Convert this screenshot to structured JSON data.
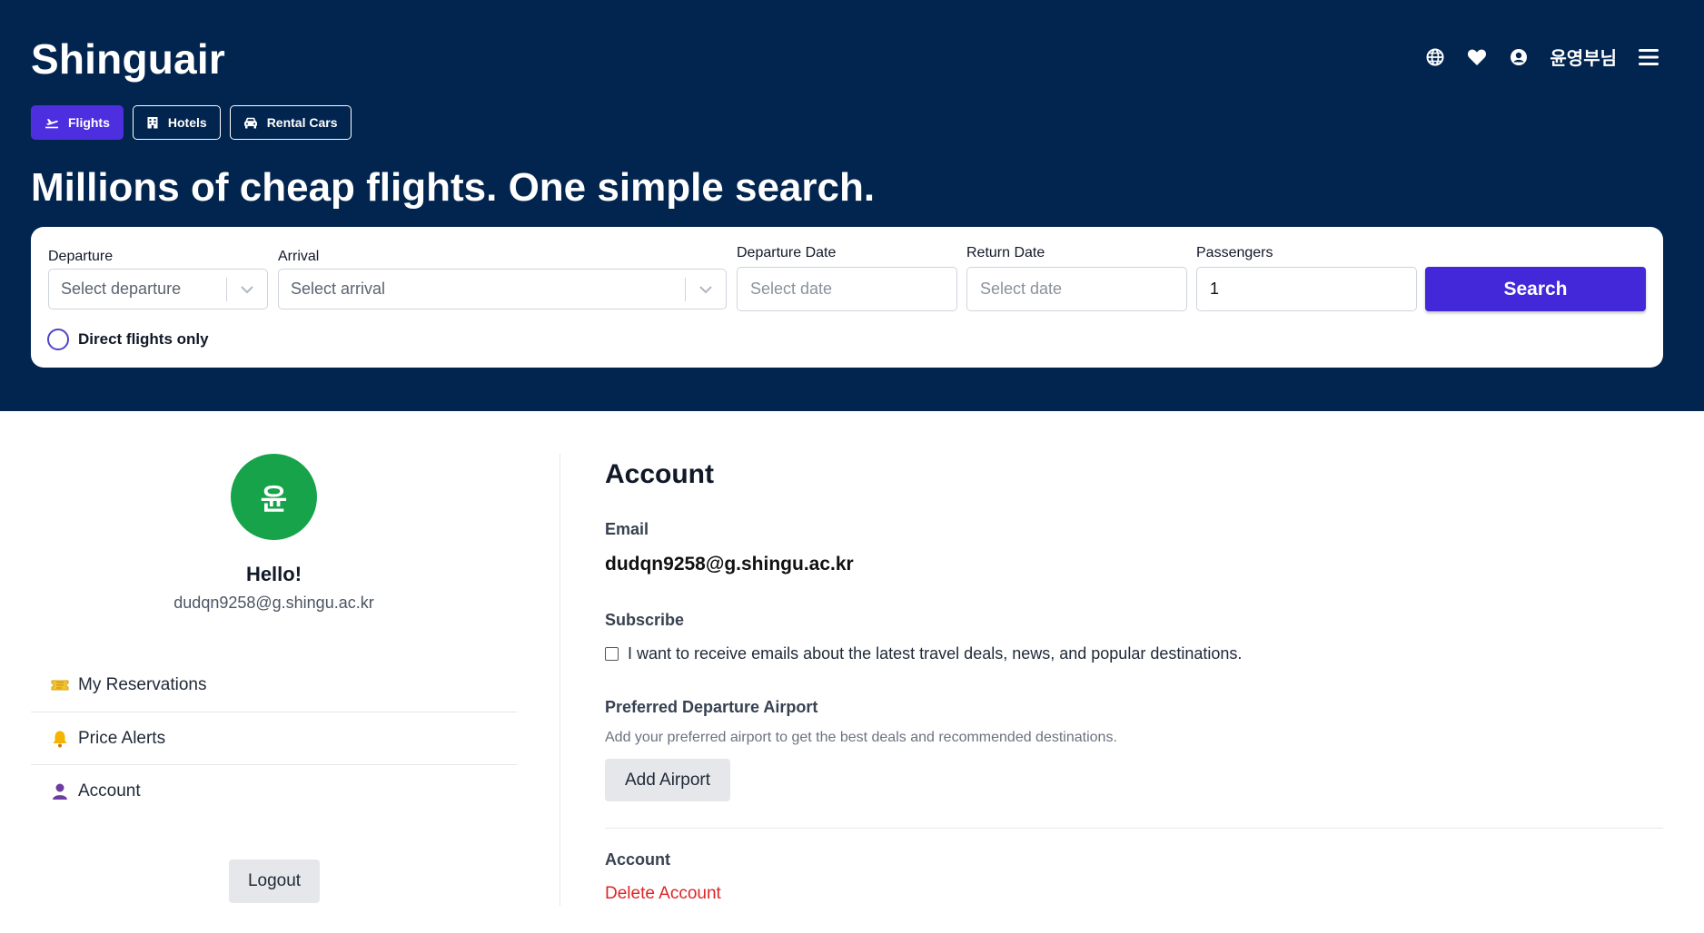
{
  "header": {
    "brand": "Shinguair",
    "user_name": "윤영부님",
    "icons": [
      "globe-icon",
      "heart-icon",
      "user-icon",
      "hamburger-menu-icon"
    ]
  },
  "categories": [
    {
      "label": "Flights",
      "icon": "plane-icon",
      "active": true
    },
    {
      "label": "Hotels",
      "icon": "hotel-icon",
      "active": false
    },
    {
      "label": "Rental Cars",
      "icon": "car-icon",
      "active": false
    }
  ],
  "hero": {
    "headline": "Millions of cheap flights. One simple search."
  },
  "search": {
    "departure_label": "Departure",
    "departure_placeholder": "Select departure",
    "arrival_label": "Arrival",
    "arrival_placeholder": "Select arrival",
    "departure_date_label": "Departure Date",
    "departure_date_placeholder": "Select date",
    "return_date_label": "Return Date",
    "return_date_placeholder": "Select date",
    "passengers_label": "Passengers",
    "passengers_value": "1",
    "search_button": "Search",
    "direct_only_label": "Direct flights only"
  },
  "profile": {
    "avatar_initial": "윤",
    "greeting": "Hello!",
    "email": "dudqn9258@g.shingu.ac.kr"
  },
  "side_menu": [
    {
      "label": "My Reservations",
      "icon": "ticket-icon"
    },
    {
      "label": "Price Alerts",
      "icon": "bell-icon"
    },
    {
      "label": "Account",
      "icon": "person-icon"
    }
  ],
  "logout_label": "Logout",
  "account": {
    "title": "Account",
    "email_label": "Email",
    "email_value": "dudqn9258@g.shingu.ac.kr",
    "subscribe_label": "Subscribe",
    "subscribe_text": "I want to receive emails about the latest travel deals, news, and popular destinations.",
    "airport_label": "Preferred Departure Airport",
    "airport_desc": "Add your preferred airport to get the best deals and recommended destinations.",
    "add_airport_button": "Add Airport",
    "section_label": "Account",
    "delete_label": "Delete Account"
  },
  "colors": {
    "hero_bg": "#02254f",
    "accent": "#4328d9",
    "avatar_bg": "#16a34a",
    "danger": "#dc2626"
  }
}
